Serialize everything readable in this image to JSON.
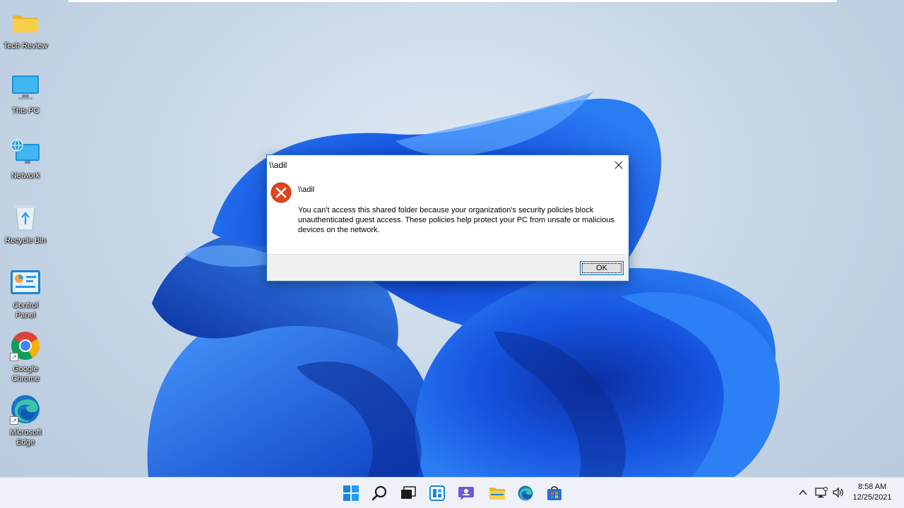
{
  "desktop": {
    "icons": [
      {
        "label": "Tech Review",
        "icon": "folder-icon"
      },
      {
        "label": "This PC",
        "icon": "monitor-icon"
      },
      {
        "label": "Network",
        "icon": "network-icon"
      },
      {
        "label": "Recycle Bin",
        "icon": "recycle-bin-icon"
      },
      {
        "label": "Control\nPanel",
        "icon": "control-panel-icon"
      },
      {
        "label": "Google\nChrome",
        "icon": "chrome-icon"
      },
      {
        "label": "Microsoft\nEdge",
        "icon": "edge-icon"
      }
    ]
  },
  "dialog": {
    "title": "\\\\adil",
    "heading": "\\\\adil",
    "message": "You can't access this shared folder because your organization's security policies block unauthenticated guest access. These policies help protect your PC from unsafe or malicious devices on the network.",
    "ok_label": "OK",
    "icon": "error-icon"
  },
  "taskbar": {
    "items": [
      "start-icon",
      "search-icon",
      "task-view-icon",
      "widgets-icon",
      "chat-icon",
      "file-explorer-icon",
      "edge-icon",
      "store-icon"
    ],
    "tray": [
      "chevron-up-icon",
      "network-icon",
      "volume-icon"
    ],
    "clock": {
      "time": "8:58 AM",
      "date": "12/25/2021"
    }
  },
  "colors": {
    "accent": "#0078d7",
    "error": "#e0451e",
    "wallpaper_blue": "#1a5ce6"
  }
}
